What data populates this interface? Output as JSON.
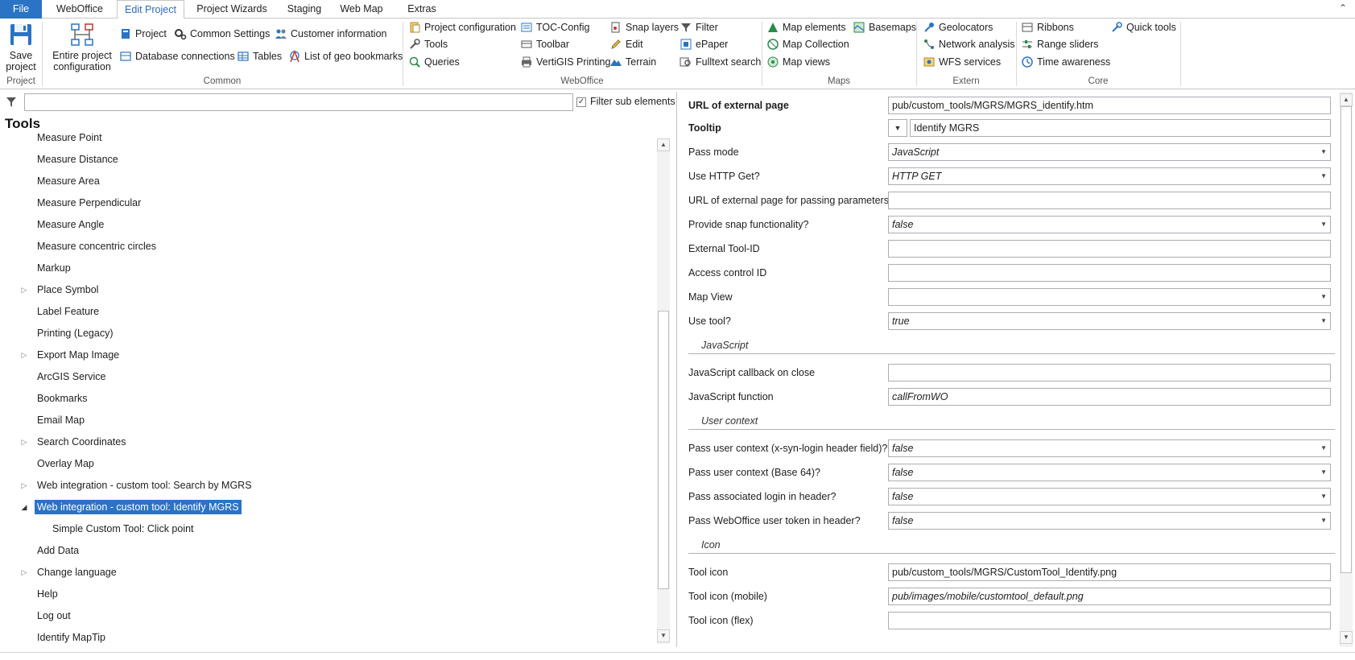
{
  "tabs": [
    {
      "label": "File"
    },
    {
      "label": "WebOffice"
    },
    {
      "label": "Edit Project"
    },
    {
      "label": "Project Wizards"
    },
    {
      "label": "Staging"
    },
    {
      "label": "Web Map"
    },
    {
      "label": "Extras"
    }
  ],
  "ribbon": {
    "groups": {
      "project": "Project",
      "common": "Common",
      "weboffice": "WebOffice",
      "maps": "Maps",
      "extern": "Extern",
      "core": "Core"
    },
    "save_project": "Save project",
    "entire_project": "Entire project configuration",
    "project": "Project",
    "common_settings": "Common Settings",
    "customer_information": "Customer information",
    "database_connections": "Database connections",
    "tables": "Tables",
    "list_geo_bookmarks": "List of geo bookmarks",
    "project_configuration": "Project configuration",
    "tools": "Tools",
    "queries": "Queries",
    "toc_config": "TOC-Config",
    "toolbar": "Toolbar",
    "vertigis_printing": "VertiGIS Printing",
    "snap_layers": "Snap layers",
    "edit": "Edit",
    "terrain": "Terrain",
    "filter": "Filter",
    "epaper": "ePaper",
    "fulltext_search": "Fulltext search",
    "map_elements": "Map elements",
    "map_collection": "Map Collection",
    "map_views": "Map views",
    "basemaps": "Basemaps",
    "geolocators": "Geolocators",
    "network_analysis": "Network analysis",
    "wfs_services": "WFS services",
    "ribbons": "Ribbons",
    "range_sliders": "Range sliders",
    "time_awareness": "Time awareness",
    "quick_tools": "Quick tools"
  },
  "filter": {
    "value": "",
    "sub_elements_label": "Filter sub elements",
    "sub_elements_checked": true
  },
  "tree": {
    "title": "Tools",
    "items": [
      {
        "label": "Measure Point"
      },
      {
        "label": "Measure Distance"
      },
      {
        "label": "Measure Area"
      },
      {
        "label": "Measure Perpendicular"
      },
      {
        "label": "Measure Angle"
      },
      {
        "label": "Measure concentric circles"
      },
      {
        "label": "Markup"
      },
      {
        "label": "Place Symbol"
      },
      {
        "label": "Label Feature"
      },
      {
        "label": "Printing (Legacy)"
      },
      {
        "label": "Export Map Image"
      },
      {
        "label": "ArcGIS Service"
      },
      {
        "label": "Bookmarks"
      },
      {
        "label": "Email Map"
      },
      {
        "label": "Search Coordinates"
      },
      {
        "label": "Overlay Map"
      },
      {
        "label": "Web integration - custom tool: Search by MGRS"
      },
      {
        "label": "Web integration - custom tool: Identify MGRS"
      },
      {
        "label": "Simple Custom Tool: Click point"
      },
      {
        "label": "Add Data"
      },
      {
        "label": "Change language"
      },
      {
        "label": "Help"
      },
      {
        "label": "Log out"
      },
      {
        "label": "Identify MapTip"
      }
    ]
  },
  "props": {
    "url_external_page": {
      "label": "URL of external page",
      "value": "pub/custom_tools/MGRS/MGRS_identify.htm"
    },
    "tooltip": {
      "label": "Tooltip",
      "value": "Identify MGRS"
    },
    "pass_mode": {
      "label": "Pass mode",
      "value": "JavaScript"
    },
    "use_http_get": {
      "label": "Use HTTP Get?",
      "value": "HTTP GET"
    },
    "url_passing_params": {
      "label": "URL of external page for passing parameters",
      "value": ""
    },
    "snap": {
      "label": "Provide snap functionality?",
      "value": "false"
    },
    "external_tool_id": {
      "label": "External Tool-ID",
      "value": ""
    },
    "access_control_id": {
      "label": "Access control ID",
      "value": ""
    },
    "map_view": {
      "label": "Map View",
      "value": ""
    },
    "use_tool": {
      "label": "Use tool?",
      "value": "true"
    },
    "section_javascript": "JavaScript",
    "js_callback": {
      "label": "JavaScript callback on close",
      "value": ""
    },
    "js_function": {
      "label": "JavaScript function",
      "value": "callFromWO"
    },
    "section_user_context": "User context",
    "user_ctx_header": {
      "label": "Pass user context (x-syn-login header field)?",
      "value": "false"
    },
    "user_ctx_b64": {
      "label": "Pass user context (Base 64)?",
      "value": "false"
    },
    "assoc_login": {
      "label": "Pass associated login in header?",
      "value": "false"
    },
    "user_token": {
      "label": "Pass WebOffice user token in header?",
      "value": "false"
    },
    "section_icon": "Icon",
    "tool_icon": {
      "label": "Tool icon",
      "value": "pub/custom_tools/MGRS/CustomTool_Identify.png"
    },
    "tool_icon_mobile": {
      "label": "Tool icon (mobile)",
      "value": "pub/images/mobile/customtool_default.png"
    },
    "tool_icon_flex": {
      "label": "Tool icon (flex)",
      "value": ""
    }
  },
  "colors": {
    "accent": "#2b73c4",
    "selection": "#2b73c4"
  }
}
